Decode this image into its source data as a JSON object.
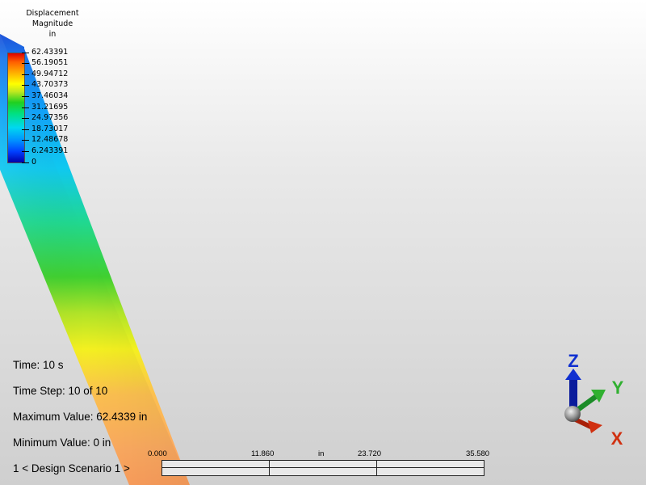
{
  "legend": {
    "title_lines": [
      "Displacement",
      "Magnitude",
      "in"
    ],
    "values": [
      "62.43391",
      "56.19051",
      "49.94712",
      "43.70373",
      "37.46034",
      "31.21695",
      "24.97356",
      "18.73017",
      "12.48678",
      "6.243391",
      "0"
    ]
  },
  "info": {
    "time": "Time: 10 s",
    "time_step": "Time Step:  10 of 10",
    "maximum": "Maximum Value: 62.4339 in",
    "minimum": "Minimum Value: 0 in",
    "scenario": "1 < Design Scenario 1 >"
  },
  "scale_bar": {
    "labels": [
      "0.000",
      "11.860",
      "in",
      "23.720",
      "35.580"
    ]
  },
  "triad": {
    "z_label": "Z",
    "y_label": "Y",
    "x_label": "X",
    "colors": {
      "z": "#1030d0",
      "y": "#30b030",
      "x": "#d03010"
    }
  },
  "colors": {
    "background_top": "#ffffff",
    "background_bottom": "#cfcfcf"
  }
}
